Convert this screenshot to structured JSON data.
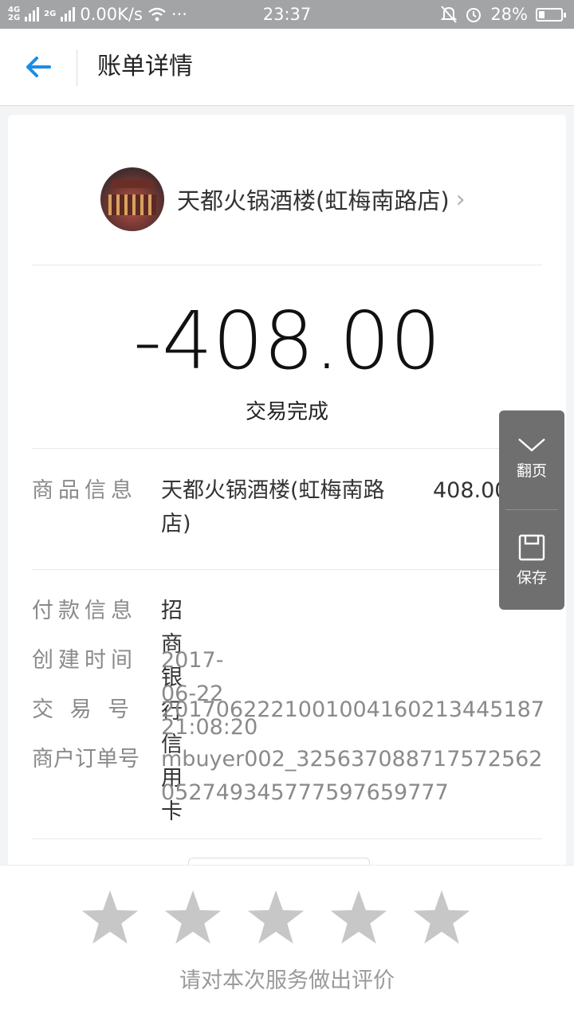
{
  "status_bar": {
    "net_top": "4G",
    "net_bottom": "2G",
    "net2": "2G",
    "speed": "0.00K/s",
    "more": "···",
    "time": "23:37",
    "battery": "28%",
    "battery_level": 0.28
  },
  "header": {
    "back_icon": "arrow-left-icon",
    "title": "账单详情"
  },
  "merchant": {
    "name": "天都火锅酒楼(虹梅南路店)",
    "chevron": "›"
  },
  "amount": "-408.00",
  "status": "交易完成",
  "goods": {
    "label": "商品信息",
    "name_line1": "天都火锅酒楼(虹梅南路",
    "name_line2": "店)",
    "price": "408.00"
  },
  "details": {
    "payment_label": "付款信息",
    "payment_value": "招商银行信用卡",
    "created_label": "创建时间",
    "created_value": "2017-06-22 21:08:20",
    "trade_no_label": "交 易 号",
    "trade_no_value": "2017062221001004160213445187",
    "order_no_label": "商户订单号",
    "order_no_line1": "mbuyer002_325637088717572562",
    "order_no_line2": "052749345777597659777"
  },
  "side_panel": {
    "page_label": "翻页",
    "save_label": "保存"
  },
  "rating": {
    "stars": 5,
    "selected": 0,
    "prompt": "请对本次服务做出评价"
  },
  "colors": {
    "accent": "#1a8ee6",
    "star_empty": "#c7c7c7",
    "panel": "#6f6f6f"
  }
}
